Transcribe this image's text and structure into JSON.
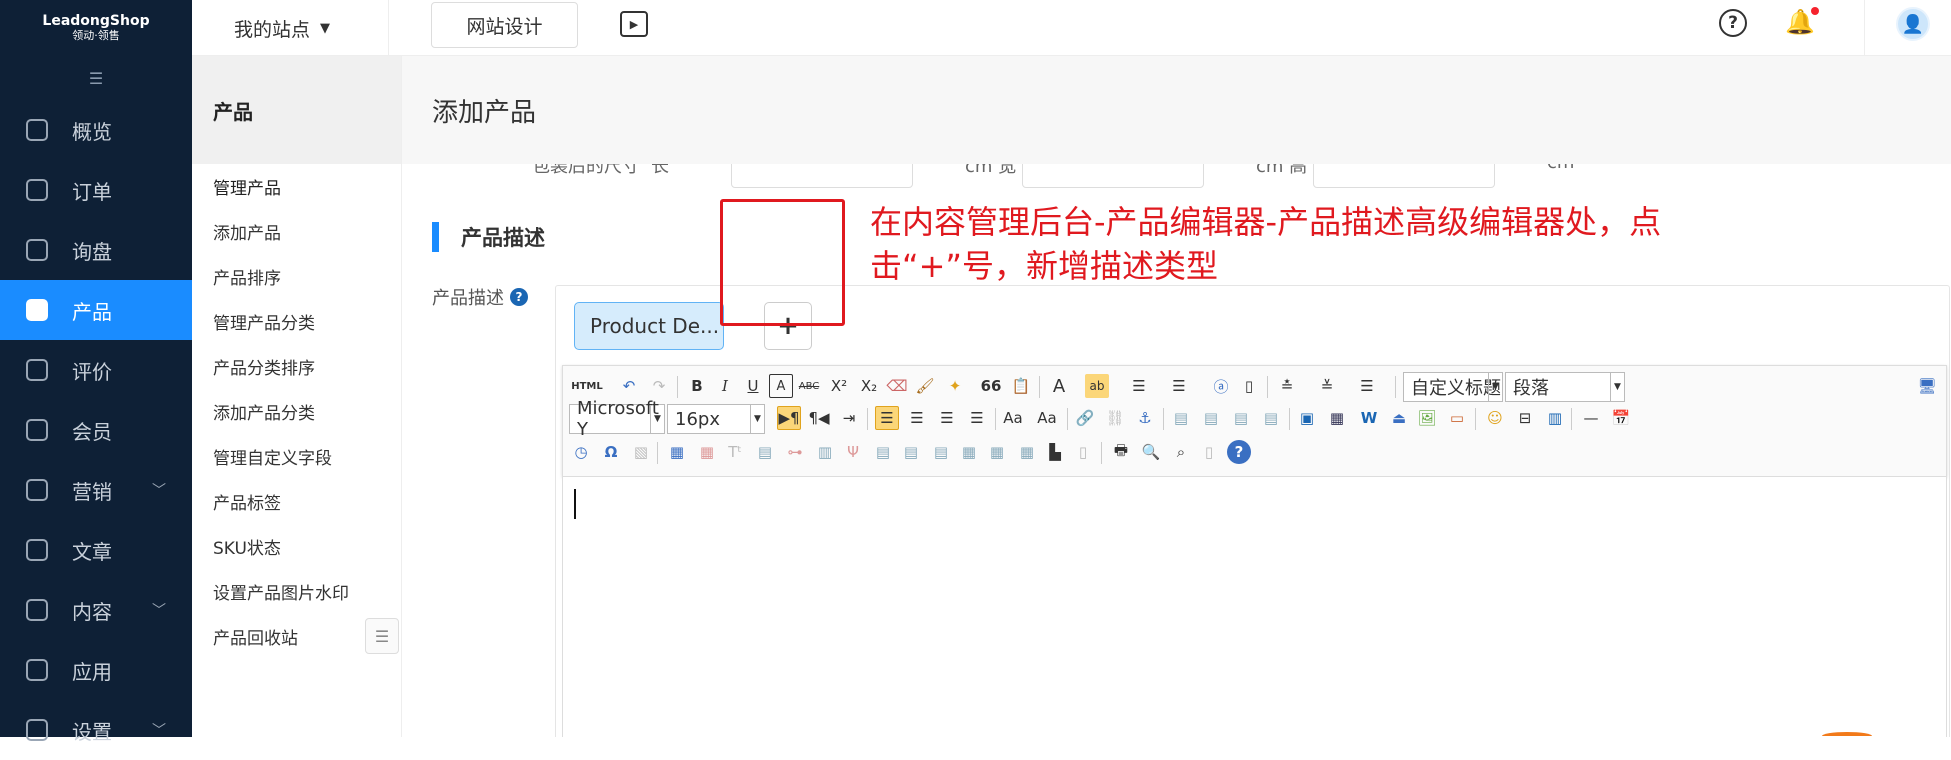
{
  "brand": {
    "name": "LeadongShop",
    "tagline": "领动·领售"
  },
  "sidebar": {
    "collapse_icon": "collapse-icon",
    "items": [
      {
        "label": "概览",
        "icon": "home-icon"
      },
      {
        "label": "订单",
        "icon": "order-icon"
      },
      {
        "label": "询盘",
        "icon": "inquiry-icon"
      },
      {
        "label": "产品",
        "icon": "bag-icon",
        "active": true
      },
      {
        "label": "评价",
        "icon": "review-icon"
      },
      {
        "label": "会员",
        "icon": "member-icon"
      },
      {
        "label": "营销",
        "icon": "marketing-icon",
        "expandable": true
      },
      {
        "label": "文章",
        "icon": "article-icon"
      },
      {
        "label": "内容",
        "icon": "content-icon",
        "expandable": true
      },
      {
        "label": "应用",
        "icon": "apps-icon"
      },
      {
        "label": "设置",
        "icon": "settings-icon",
        "expandable": true
      }
    ]
  },
  "topbar": {
    "site_selector": "我的站点",
    "design_button": "网站设计",
    "icons": [
      "video-icon",
      "help-icon",
      "bell-icon",
      "avatar"
    ]
  },
  "subnav": {
    "title": "产品",
    "items": [
      "管理产品",
      "添加产品",
      "产品排序",
      "管理产品分类",
      "产品分类排序",
      "添加产品分类",
      "管理自定义字段",
      "产品标签",
      "SKU状态",
      "设置产品图片水印",
      "产品回收站"
    ]
  },
  "main": {
    "page_title": "添加产品",
    "size_row": {
      "l1": "包装后的尺寸",
      "l2": "长",
      "u1": "cm 宽",
      "u2": "cm 高",
      "u3": "cm"
    },
    "section_title": "产品描述",
    "desc_label": "产品描述",
    "desc_tab": "Product De...",
    "add_button": "+",
    "annotation": "在内容管理后台-产品编辑器-产品描述高级编辑器处，点击“+”号，新增描述类型"
  },
  "toolbar": {
    "font_family": "Microsoft Y",
    "font_size": "16px",
    "heading": "自定义标题",
    "paragraph": "段落",
    "html_label": "HTML",
    "bold": "B",
    "italic": "I",
    "underline": "U",
    "strike": "ABC",
    "quote": "66",
    "omega": "Ω",
    "help": "?"
  }
}
